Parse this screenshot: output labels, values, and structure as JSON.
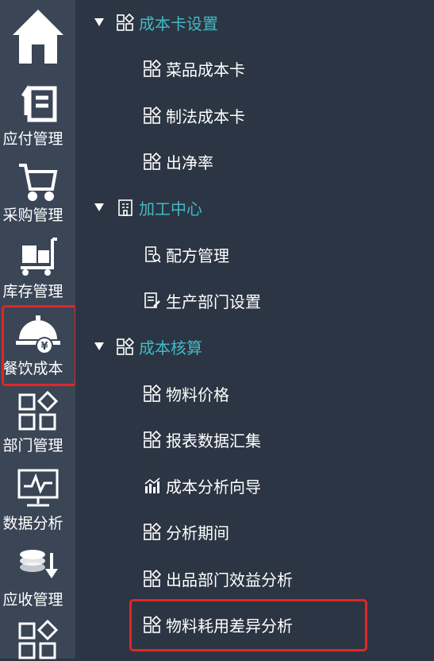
{
  "rail": {
    "items": [
      {
        "icon": "home-icon",
        "label": ""
      },
      {
        "icon": "payable-list-icon",
        "label": "应付管理"
      },
      {
        "icon": "shopping-cart-icon",
        "label": "采购管理"
      },
      {
        "icon": "inventory-cart-icon",
        "label": "库存管理"
      },
      {
        "icon": "cloche-yen-icon",
        "label": "餐饮成本"
      },
      {
        "icon": "grid-diamond-icon",
        "label": "部门管理"
      },
      {
        "icon": "monitor-chart-icon",
        "label": "数据分析"
      },
      {
        "icon": "coins-arrow-icon",
        "label": "应收管理"
      },
      {
        "icon": "grid-diamond-icon",
        "label": ""
      }
    ]
  },
  "tree": {
    "groups": [
      {
        "label": "成本卡设置",
        "icon": "grid-diamond-icon",
        "children": [
          {
            "label": "菜品成本卡",
            "icon": "grid-diamond-icon"
          },
          {
            "label": "制法成本卡",
            "icon": "grid-diamond-icon"
          },
          {
            "label": "出净率",
            "icon": "grid-diamond-icon"
          }
        ]
      },
      {
        "label": "加工中心",
        "icon": "building-icon",
        "children": [
          {
            "label": "配方管理",
            "icon": "recipe-doc-icon"
          },
          {
            "label": "生产部门设置",
            "icon": "doc-edit-icon"
          }
        ]
      },
      {
        "label": "成本核算",
        "icon": "grid-diamond-icon",
        "children": [
          {
            "label": "物料价格",
            "icon": "grid-diamond-icon"
          },
          {
            "label": "报表数据汇集",
            "icon": "grid-diamond-icon"
          },
          {
            "label": "成本分析向导",
            "icon": "bar-chart-icon"
          },
          {
            "label": "分析期间",
            "icon": "grid-diamond-icon"
          },
          {
            "label": "出品部门效益分析",
            "icon": "grid-diamond-icon"
          },
          {
            "label": "物料耗用差异分析",
            "icon": "grid-diamond-icon"
          }
        ]
      }
    ]
  },
  "colors": {
    "highlight": "#e02626",
    "group_text": "#41b9c6",
    "rail_bg": "#3a4556",
    "panel_bg": "#2c3543"
  }
}
